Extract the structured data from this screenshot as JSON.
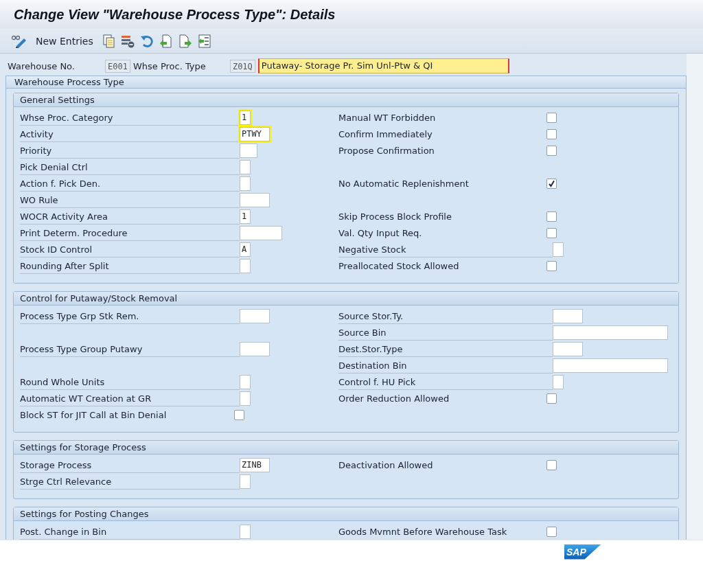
{
  "window": {
    "title": "Change View \"Warehouse Process Type\": Details"
  },
  "toolbar": {
    "new_entries": "New Entries"
  },
  "header": {
    "warehouse_label": "Warehouse No.",
    "warehouse_value": "E001",
    "type_label": "Whse Proc. Type",
    "type_value": "Z01Q",
    "description": "Putaway- Storage Pr. Sim Unl-Ptw & QI",
    "description_focused": true
  },
  "frame": {
    "title": "Warehouse Process Type",
    "groups": [
      {
        "title": "General Settings",
        "rows": [
          {
            "left": {
              "kind": "char",
              "label": "Whse Proc. Category",
              "value": "1",
              "highlighted": true
            },
            "right": {
              "kind": "checkbox",
              "label": "Manual WT Forbidden",
              "checked": false
            }
          },
          {
            "left": {
              "kind": "code",
              "label": "Activity",
              "value": "PTWY",
              "highlighted": true
            },
            "right": {
              "kind": "checkbox",
              "label": "Confirm Immediately",
              "checked": false
            }
          },
          {
            "left": {
              "kind": "short",
              "label": "Priority",
              "highlighted": false
            },
            "right": {
              "kind": "checkbox",
              "label": "Propose Confirmation",
              "checked": false
            }
          },
          {
            "left": {
              "kind": "char",
              "label": "Pick Denial Ctrl",
              "highlighted": false
            }
          },
          {
            "left": {
              "kind": "char",
              "label": "Action f. Pick Den.",
              "highlighted": false
            },
            "right": {
              "kind": "checkbox",
              "label": "No Automatic Replenishment",
              "checked": true
            }
          },
          {
            "left": {
              "kind": "code",
              "label": "WO Rule",
              "highlighted": false
            }
          },
          {
            "left": {
              "kind": "char",
              "label": "WOCR Activity Area",
              "value": "1",
              "highlighted": false
            },
            "right": {
              "kind": "checkbox",
              "label": "Skip Process Block Profile",
              "checked": false
            }
          },
          {
            "left": {
              "kind": "text",
              "label": "Print Determ. Procedure",
              "highlighted": false
            },
            "right": {
              "kind": "checkbox",
              "label": "Val. Qty Input Req.",
              "checked": false
            }
          },
          {
            "left": {
              "kind": "char",
              "label": "Stock ID Control",
              "value": "A",
              "highlighted": false
            },
            "right": {
              "kind": "char",
              "label": "Negative Stock",
              "highlighted": false
            }
          },
          {
            "left": {
              "kind": "char",
              "label": "Rounding After Split",
              "highlighted": false
            },
            "right": {
              "kind": "checkbox",
              "label": "Preallocated Stock Allowed",
              "checked": false
            }
          }
        ]
      },
      {
        "title": "Control for Putaway/Stock Removal",
        "rows": [
          {
            "left": {
              "kind": "code",
              "label": "Process Type Grp Stk Rem.",
              "highlighted": false
            },
            "right": {
              "kind": "code",
              "label": "Source Stor.Ty.",
              "highlighted": false
            }
          },
          {
            "right": {
              "kind": "long",
              "label": "Source Bin",
              "highlighted": false
            }
          },
          {
            "left": {
              "kind": "code",
              "label": "Process Type Group Putawy",
              "highlighted": false
            },
            "right": {
              "kind": "code",
              "label": "Dest.Stor.Type",
              "highlighted": false
            }
          },
          {
            "right": {
              "kind": "long",
              "label": "Destination Bin",
              "highlighted": false
            }
          },
          {
            "left": {
              "kind": "char",
              "label": "Round Whole Units",
              "highlighted": false
            },
            "right": {
              "kind": "char",
              "label": "Control f. HU Pick",
              "highlighted": false
            }
          },
          {
            "left": {
              "kind": "char",
              "label": "Automatic WT Creation at GR",
              "highlighted": false
            },
            "right": {
              "kind": "checkbox",
              "label": "Order Reduction Allowed",
              "checked": false
            }
          },
          {
            "left": {
              "kind": "checkbox",
              "label": "Block ST for JIT Call at Bin Denial",
              "checked": false
            }
          }
        ]
      },
      {
        "title": "Settings for Storage Process",
        "rows": [
          {
            "left": {
              "kind": "code",
              "label": "Storage Process",
              "value": "ZINB",
              "highlighted": false
            },
            "right": {
              "kind": "checkbox",
              "label": "Deactivation Allowed",
              "checked": false
            }
          },
          {
            "left": {
              "kind": "char",
              "label": "Strge Ctrl Relevance",
              "highlighted": false
            }
          }
        ]
      },
      {
        "title": "Settings for Posting Changes",
        "rows": [
          {
            "left": {
              "kind": "char",
              "label": "Post. Change in Bin",
              "highlighted": false
            },
            "right": {
              "kind": "checkbox",
              "label": "Goods Mvmnt Before Warehouse Task",
              "checked": false
            }
          }
        ]
      }
    ]
  },
  "footer": {
    "logo": "SAP"
  }
}
